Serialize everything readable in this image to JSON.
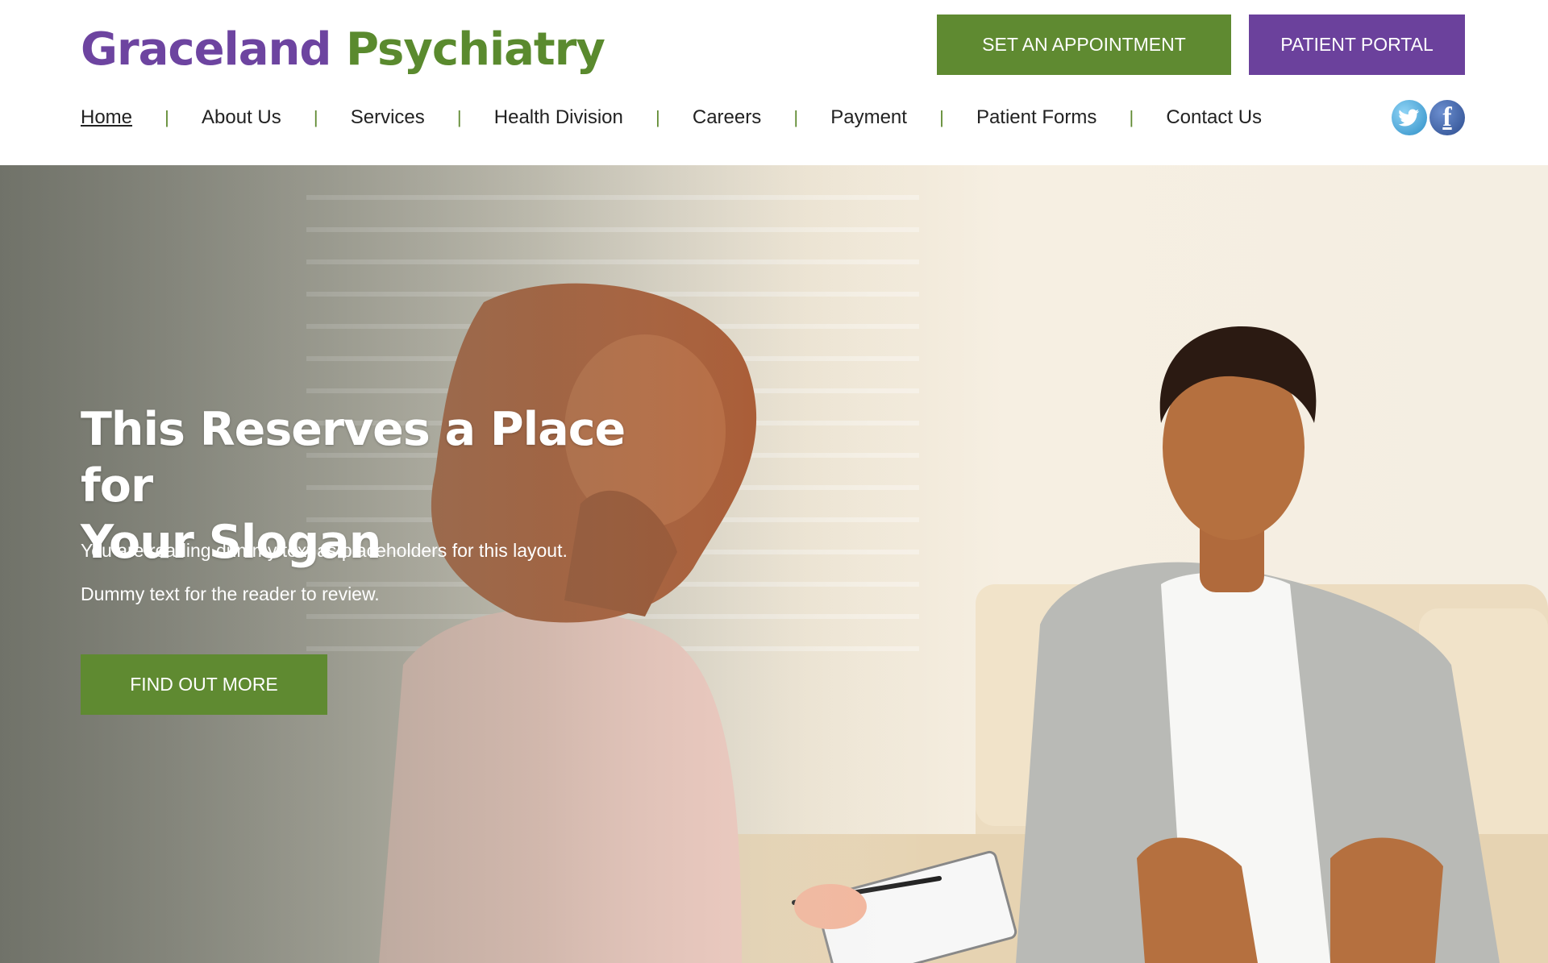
{
  "brand": {
    "name_part1": "Graceland",
    "name_part2": "Psychiatry",
    "color_primary": "#6d44a0",
    "color_secondary": "#5a8a2e"
  },
  "header_buttons": {
    "appointment_label": "SET AN APPOINTMENT",
    "portal_label": "PATIENT PORTAL"
  },
  "nav": {
    "items": [
      {
        "label": "Home",
        "active": true
      },
      {
        "label": "About Us"
      },
      {
        "label": "Services"
      },
      {
        "label": "Health Division"
      },
      {
        "label": "Careers"
      },
      {
        "label": "Payment"
      },
      {
        "label": "Patient Forms"
      },
      {
        "label": "Contact Us"
      }
    ],
    "separator": "|"
  },
  "social": {
    "twitter_icon": "twitter-icon",
    "facebook_icon": "facebook-icon",
    "facebook_glyph": "f"
  },
  "hero": {
    "slogan_line1": "This Reserves a Place for",
    "slogan_line2": "Your Slogan",
    "paragraph1": "You are reading dummy text as placeholders for this layout.",
    "paragraph2": "Dummy text for the reader to review.",
    "cta_label": "FIND OUT MORE"
  },
  "colors": {
    "green": "#5f8a31",
    "purple": "#6b419c"
  }
}
